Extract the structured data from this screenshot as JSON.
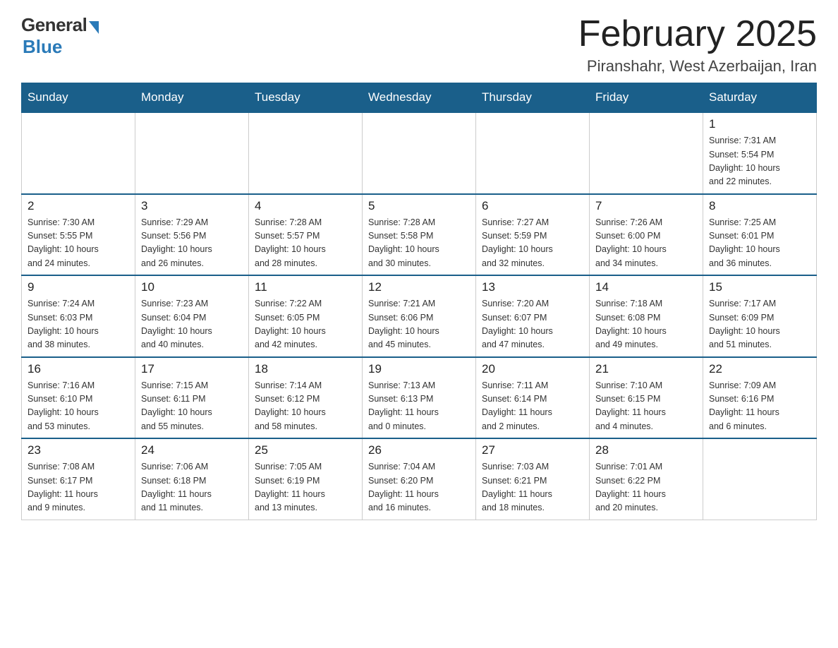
{
  "header": {
    "logo_general": "General",
    "logo_blue": "Blue",
    "month_title": "February 2025",
    "location": "Piranshahr, West Azerbaijan, Iran"
  },
  "weekdays": [
    "Sunday",
    "Monday",
    "Tuesday",
    "Wednesday",
    "Thursday",
    "Friday",
    "Saturday"
  ],
  "weeks": [
    {
      "days": [
        {
          "number": "",
          "info": ""
        },
        {
          "number": "",
          "info": ""
        },
        {
          "number": "",
          "info": ""
        },
        {
          "number": "",
          "info": ""
        },
        {
          "number": "",
          "info": ""
        },
        {
          "number": "",
          "info": ""
        },
        {
          "number": "1",
          "info": "Sunrise: 7:31 AM\nSunset: 5:54 PM\nDaylight: 10 hours\nand 22 minutes."
        }
      ]
    },
    {
      "days": [
        {
          "number": "2",
          "info": "Sunrise: 7:30 AM\nSunset: 5:55 PM\nDaylight: 10 hours\nand 24 minutes."
        },
        {
          "number": "3",
          "info": "Sunrise: 7:29 AM\nSunset: 5:56 PM\nDaylight: 10 hours\nand 26 minutes."
        },
        {
          "number": "4",
          "info": "Sunrise: 7:28 AM\nSunset: 5:57 PM\nDaylight: 10 hours\nand 28 minutes."
        },
        {
          "number": "5",
          "info": "Sunrise: 7:28 AM\nSunset: 5:58 PM\nDaylight: 10 hours\nand 30 minutes."
        },
        {
          "number": "6",
          "info": "Sunrise: 7:27 AM\nSunset: 5:59 PM\nDaylight: 10 hours\nand 32 minutes."
        },
        {
          "number": "7",
          "info": "Sunrise: 7:26 AM\nSunset: 6:00 PM\nDaylight: 10 hours\nand 34 minutes."
        },
        {
          "number": "8",
          "info": "Sunrise: 7:25 AM\nSunset: 6:01 PM\nDaylight: 10 hours\nand 36 minutes."
        }
      ]
    },
    {
      "days": [
        {
          "number": "9",
          "info": "Sunrise: 7:24 AM\nSunset: 6:03 PM\nDaylight: 10 hours\nand 38 minutes."
        },
        {
          "number": "10",
          "info": "Sunrise: 7:23 AM\nSunset: 6:04 PM\nDaylight: 10 hours\nand 40 minutes."
        },
        {
          "number": "11",
          "info": "Sunrise: 7:22 AM\nSunset: 6:05 PM\nDaylight: 10 hours\nand 42 minutes."
        },
        {
          "number": "12",
          "info": "Sunrise: 7:21 AM\nSunset: 6:06 PM\nDaylight: 10 hours\nand 45 minutes."
        },
        {
          "number": "13",
          "info": "Sunrise: 7:20 AM\nSunset: 6:07 PM\nDaylight: 10 hours\nand 47 minutes."
        },
        {
          "number": "14",
          "info": "Sunrise: 7:18 AM\nSunset: 6:08 PM\nDaylight: 10 hours\nand 49 minutes."
        },
        {
          "number": "15",
          "info": "Sunrise: 7:17 AM\nSunset: 6:09 PM\nDaylight: 10 hours\nand 51 minutes."
        }
      ]
    },
    {
      "days": [
        {
          "number": "16",
          "info": "Sunrise: 7:16 AM\nSunset: 6:10 PM\nDaylight: 10 hours\nand 53 minutes."
        },
        {
          "number": "17",
          "info": "Sunrise: 7:15 AM\nSunset: 6:11 PM\nDaylight: 10 hours\nand 55 minutes."
        },
        {
          "number": "18",
          "info": "Sunrise: 7:14 AM\nSunset: 6:12 PM\nDaylight: 10 hours\nand 58 minutes."
        },
        {
          "number": "19",
          "info": "Sunrise: 7:13 AM\nSunset: 6:13 PM\nDaylight: 11 hours\nand 0 minutes."
        },
        {
          "number": "20",
          "info": "Sunrise: 7:11 AM\nSunset: 6:14 PM\nDaylight: 11 hours\nand 2 minutes."
        },
        {
          "number": "21",
          "info": "Sunrise: 7:10 AM\nSunset: 6:15 PM\nDaylight: 11 hours\nand 4 minutes."
        },
        {
          "number": "22",
          "info": "Sunrise: 7:09 AM\nSunset: 6:16 PM\nDaylight: 11 hours\nand 6 minutes."
        }
      ]
    },
    {
      "days": [
        {
          "number": "23",
          "info": "Sunrise: 7:08 AM\nSunset: 6:17 PM\nDaylight: 11 hours\nand 9 minutes."
        },
        {
          "number": "24",
          "info": "Sunrise: 7:06 AM\nSunset: 6:18 PM\nDaylight: 11 hours\nand 11 minutes."
        },
        {
          "number": "25",
          "info": "Sunrise: 7:05 AM\nSunset: 6:19 PM\nDaylight: 11 hours\nand 13 minutes."
        },
        {
          "number": "26",
          "info": "Sunrise: 7:04 AM\nSunset: 6:20 PM\nDaylight: 11 hours\nand 16 minutes."
        },
        {
          "number": "27",
          "info": "Sunrise: 7:03 AM\nSunset: 6:21 PM\nDaylight: 11 hours\nand 18 minutes."
        },
        {
          "number": "28",
          "info": "Sunrise: 7:01 AM\nSunset: 6:22 PM\nDaylight: 11 hours\nand 20 minutes."
        },
        {
          "number": "",
          "info": ""
        }
      ]
    }
  ]
}
